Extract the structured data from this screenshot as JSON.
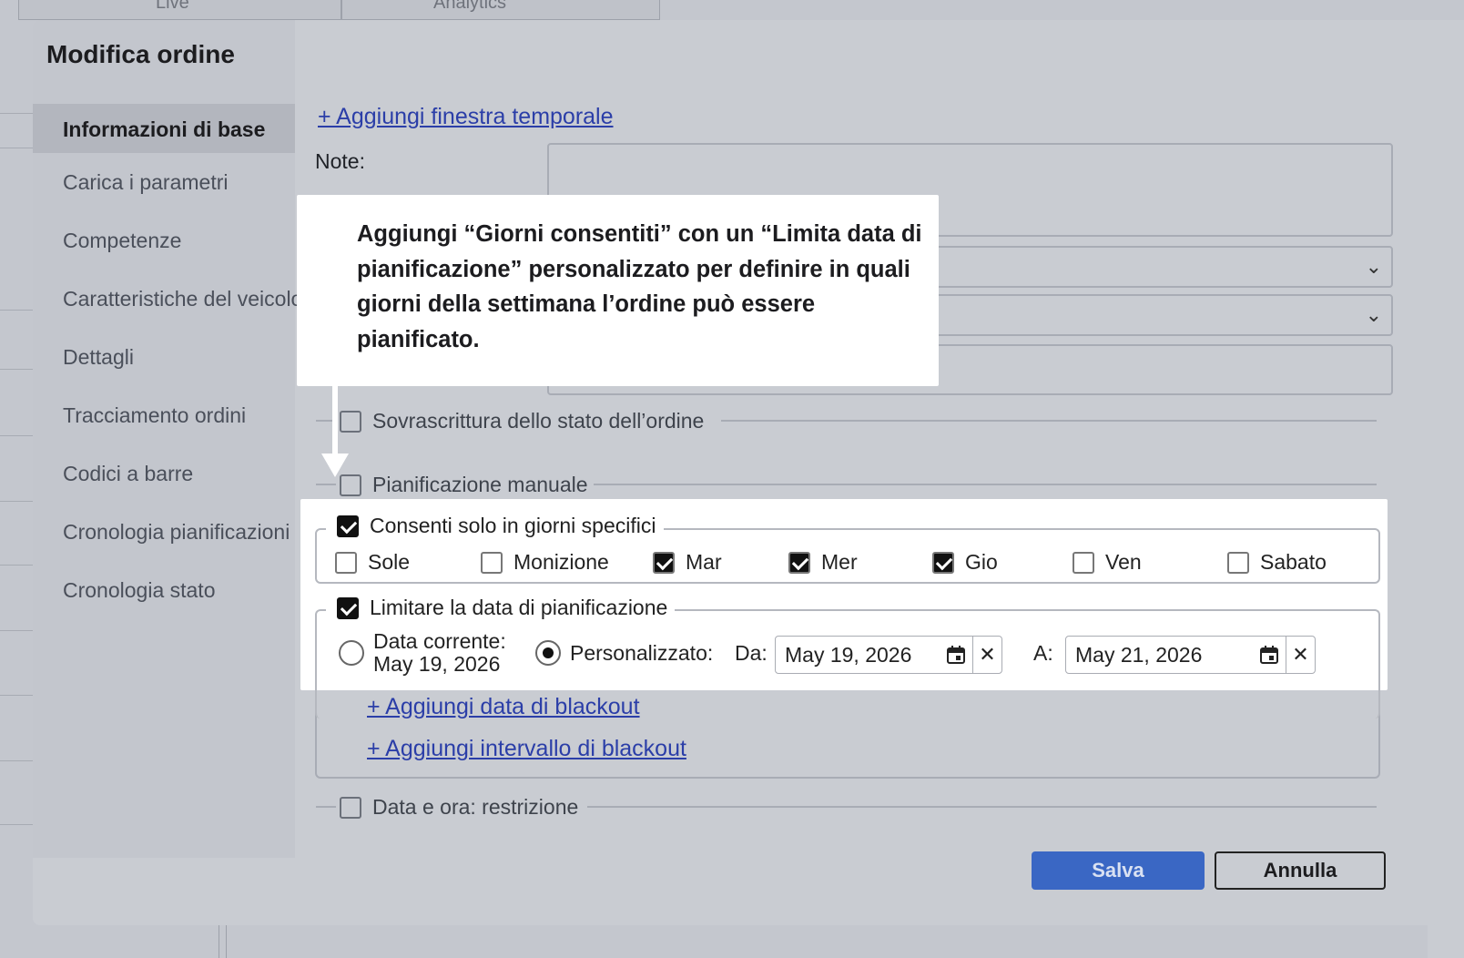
{
  "background": {
    "tabs": [
      "Live",
      "Analytics"
    ]
  },
  "modal": {
    "title": "Modifica ordine",
    "nav": [
      {
        "label": "Informazioni di base",
        "active": true
      },
      {
        "label": "Carica i parametri",
        "active": false
      },
      {
        "label": "Competenze",
        "active": false
      },
      {
        "label": "Caratteristiche del veicolo",
        "active": false
      },
      {
        "label": "Dettagli",
        "active": false
      },
      {
        "label": "Tracciamento ordini",
        "active": false
      },
      {
        "label": "Codici a barre",
        "active": false
      },
      {
        "label": "Cronologia pianificazioni",
        "active": false
      },
      {
        "label": "Cronologia stato",
        "active": false
      }
    ],
    "form": {
      "add_time_window": "+ Aggiungi finestra temporale",
      "notes_label": "Note:",
      "status_override": "Sovrascrittura dello stato dell’ordine",
      "manual_planning": "Pianificazione manuale",
      "allowed_days": {
        "label": "Consenti solo in giorni specifici",
        "checked": true,
        "days": [
          {
            "label": "Sole",
            "checked": false
          },
          {
            "label": "Monizione",
            "checked": false
          },
          {
            "label": "Mar",
            "checked": true
          },
          {
            "label": "Mer",
            "checked": true
          },
          {
            "label": "Gio",
            "checked": true
          },
          {
            "label": "Ven",
            "checked": false
          },
          {
            "label": "Sabato",
            "checked": false
          }
        ]
      },
      "limit_date": {
        "label": "Limitare la data di pianificazione",
        "checked": true,
        "current_date_label": "Data corrente:",
        "current_date_value": "May 19, 2026",
        "custom_label": "Personalizzato:",
        "selected": "custom",
        "from_label": "Da:",
        "from_value": "May 19, 2026",
        "to_label": "A:",
        "to_value": "May 21, 2026"
      },
      "add_blackout_date": "+ Aggiungi data di blackout",
      "add_blackout_range": "+ Aggiungi intervallo di blackout",
      "datetime_restriction": "Data e ora: restrizione"
    },
    "footer": {
      "save": "Salva",
      "cancel": "Annulla"
    }
  },
  "callout": {
    "text": "Aggiungi “Giorni consentiti” con un “Limita data di pianificazione” personalizzato per definire in quali giorni della settimana l’ordine può essere pianificato."
  }
}
